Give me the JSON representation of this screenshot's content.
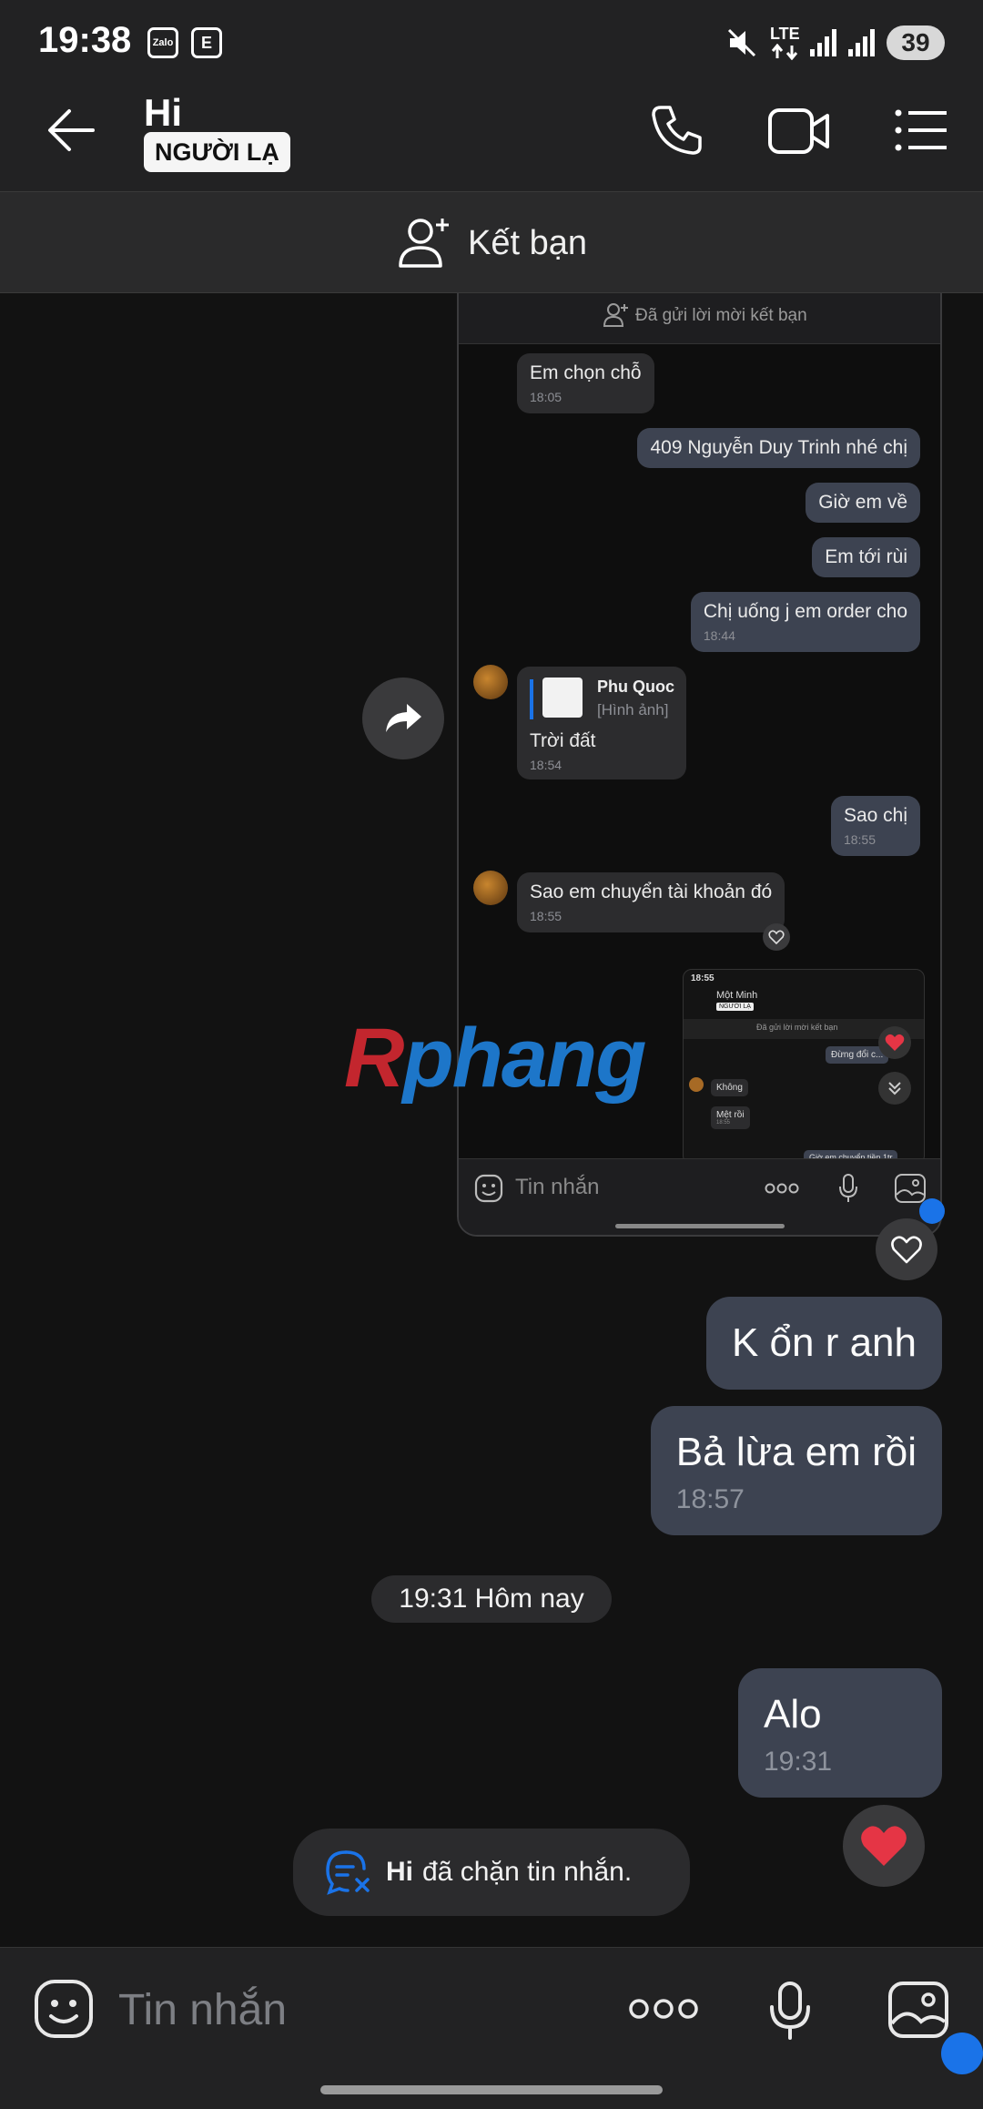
{
  "status_bar": {
    "time": "19:38",
    "app_icon_1": "Zalo",
    "app_icon_2": "E",
    "network": "LTE",
    "battery": "39",
    "icons": [
      "mute-icon",
      "lte-icon",
      "signal-icon",
      "signal-icon",
      "battery-icon"
    ]
  },
  "header": {
    "title": "Hi",
    "badge": "NGƯỜI LẠ",
    "icons": [
      "back-arrow-icon",
      "phone-icon",
      "video-call-icon",
      "menu-list-icon"
    ]
  },
  "add_friend": {
    "label": "Kết bạn"
  },
  "embedded_screenshot": {
    "notice": "Đã gửi lời mời kết bạn",
    "messages": [
      {
        "dir": "in",
        "text": "Em chọn chỗ",
        "time": "18:05"
      },
      {
        "dir": "out",
        "text": "409 Nguyễn Duy Trinh nhé chị"
      },
      {
        "dir": "out",
        "text": "Giờ em về"
      },
      {
        "dir": "out",
        "text": "Em tới rùi"
      },
      {
        "dir": "out",
        "text": "Chị uống j em order cho",
        "time": "18:44"
      },
      {
        "dir": "in",
        "quote_name": "Phu Quoc",
        "quote_type": "[Hình ảnh]",
        "text": "Trời đất",
        "time": "18:54"
      },
      {
        "dir": "out",
        "text": "Sao chị",
        "time": "18:55"
      },
      {
        "dir": "in",
        "text": "Sao em chuyển tài khoản đó",
        "time": "18:55"
      }
    ],
    "nested": {
      "time": "18:55",
      "name": "Một Minh",
      "badge": "NGƯỜI LẠ",
      "notice": "Đã gửi lời mời kết bạn",
      "out_1": "Đừng đổi c...",
      "in_1": "Không",
      "in_2": "Mệt rồi",
      "in_2_time": "18:55",
      "out_2": "Giờ em chuyển tiền 1tr"
    },
    "composer_placeholder": "Tin nhắn"
  },
  "watermark": "Rphang",
  "messages": [
    {
      "dir": "out",
      "text": "K ổn r anh"
    },
    {
      "dir": "out",
      "text": "Bả lừa em rồi",
      "time": "18:57"
    }
  ],
  "date_separator": "19:31 Hôm nay",
  "latest": {
    "dir": "out",
    "text": "Alo",
    "time": "19:31"
  },
  "blocked_notice": {
    "name": "Hi",
    "text": "đã chặn tin nhắn."
  },
  "composer": {
    "placeholder": "Tin nhắn"
  },
  "colors": {
    "accent": "#1a73e8",
    "bubble_out": "#3d4351",
    "bubble_in": "#2c2c2e",
    "heart": "#e53545"
  }
}
